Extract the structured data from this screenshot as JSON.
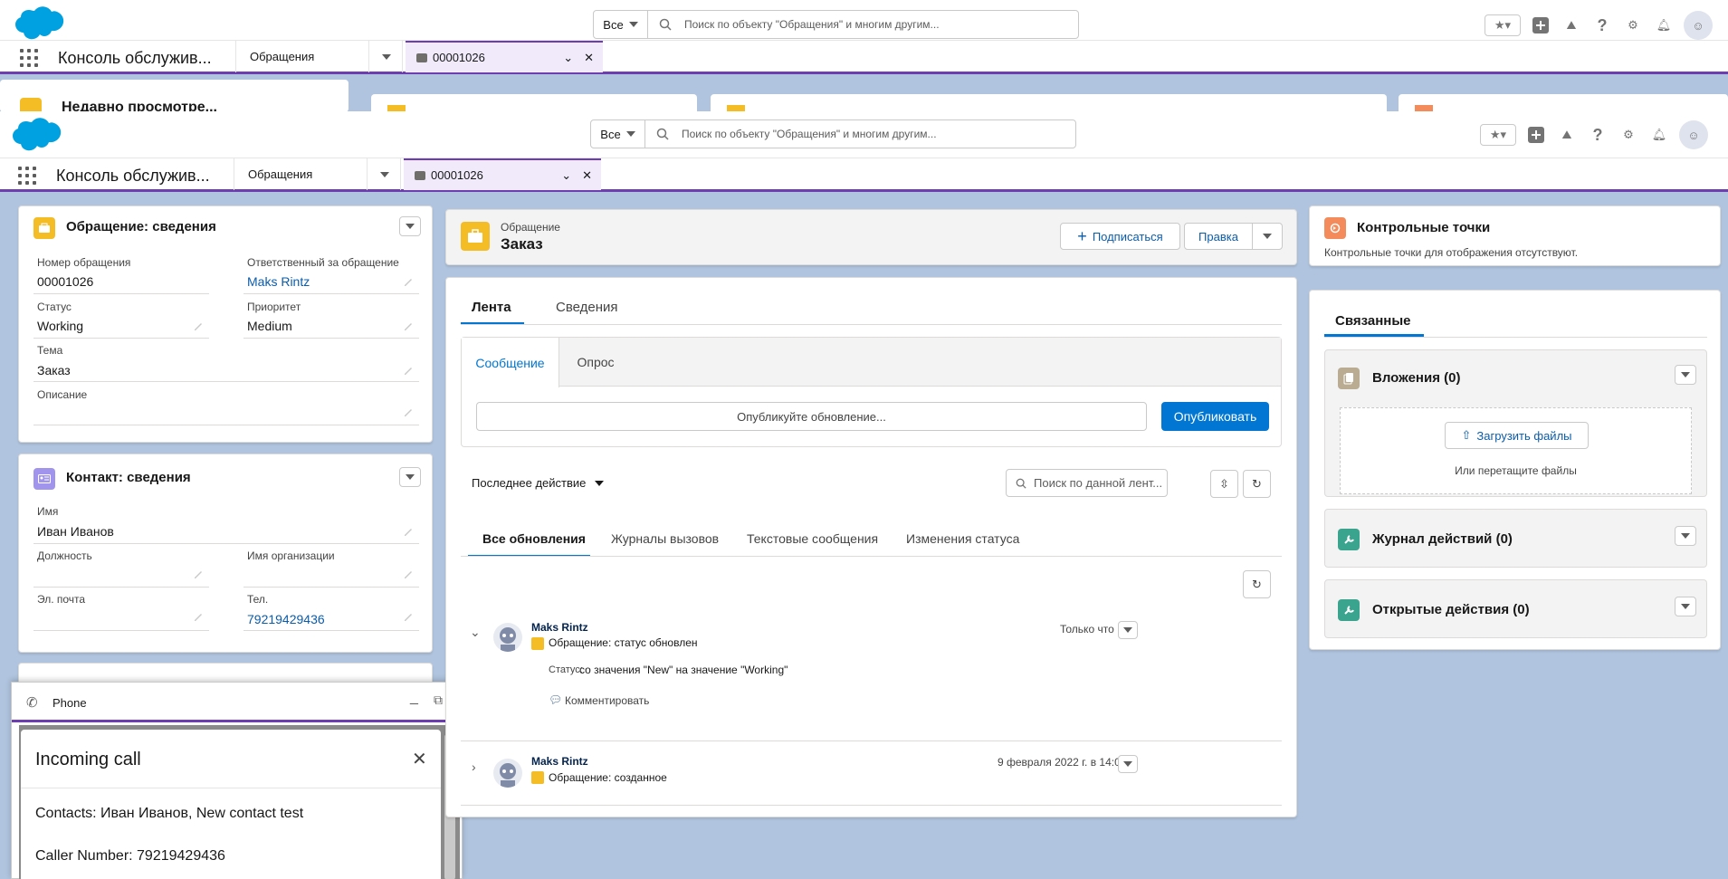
{
  "header": {
    "search_scope": "Все",
    "search_placeholder": "Поиск по объекту \"Обращения\" и многим другим..."
  },
  "nav": {
    "app_name": "Консоль обслужив...",
    "tab1_label": "Обращения",
    "tab2_label": "00001026"
  },
  "bg_fragments": {
    "recent_title": "Недавно просмотре..."
  },
  "case_details": {
    "title": "Обращение: сведения",
    "fields": {
      "number_label": "Номер обращения",
      "number_value": "00001026",
      "owner_label": "Ответственный за обращение",
      "owner_value": "Maks Rintz",
      "status_label": "Статус",
      "status_value": "Working",
      "priority_label": "Приоритет",
      "priority_value": "Medium",
      "subject_label": "Тема",
      "subject_value": "Заказ",
      "description_label": "Описание"
    }
  },
  "contact_details": {
    "title": "Контакт: сведения",
    "fields": {
      "name_label": "Имя",
      "name_value": "Иван Иванов",
      "title_label": "Должность",
      "org_label": "Имя организации",
      "email_label": "Эл. почта",
      "phone_label": "Тел.",
      "phone_value": "79219429436"
    }
  },
  "phone_panel": {
    "title": "Phone",
    "incoming_title": "Incoming call",
    "contacts_line": "Contacts: Иван Иванов, New contact test",
    "caller_line": "Caller Number: 79219429436"
  },
  "record_header": {
    "object_label": "Обращение",
    "record_name": "Заказ",
    "follow_label": "Подписаться",
    "edit_label": "Правка"
  },
  "feed": {
    "tabs": [
      "Лента",
      "Сведения"
    ],
    "publisher_tabs": [
      "Сообщение",
      "Опрос"
    ],
    "publisher_placeholder": "Опубликуйте обновление...",
    "publish_label": "Опубликовать",
    "sort_label": "Последнее действие",
    "search_placeholder": "Поиск по данной лент...",
    "filter_tabs": [
      "Все обновления",
      "Журналы вызовов",
      "Текстовые сообщения",
      "Изменения статуса"
    ],
    "items": [
      {
        "author": "Maks Rintz",
        "subtitle": "Обращение: статус обновлен",
        "time": "Только что",
        "detail_label": "Статус:",
        "detail_text": "со значения \"New\" на значение \"Working\"",
        "comment_label": "Комментировать"
      },
      {
        "author": "Maks Rintz",
        "subtitle": "Обращение: созданное",
        "time": "9 февраля 2022 г. в 14:03"
      }
    ]
  },
  "milestones": {
    "title": "Контрольные точки",
    "empty_text": "Контрольные точки для отображения отсутствуют."
  },
  "related": {
    "tab_label": "Связанные",
    "attachments_title": "Вложения (0)",
    "upload_label": "Загрузить файлы",
    "drop_label": "Или перетащите файлы",
    "activity_title": "Журнал действий (0)",
    "open_activities_title": "Открытые действия (0)"
  },
  "colors": {
    "brand": "#0176d3",
    "nav_accent": "#6c3eb0",
    "case_icon": "#f4bc25",
    "contact_icon": "#a094ed",
    "milestone_icon": "#f38b5a",
    "attachment_icon": "#baac93",
    "activity_icon": "#3ba48f"
  }
}
